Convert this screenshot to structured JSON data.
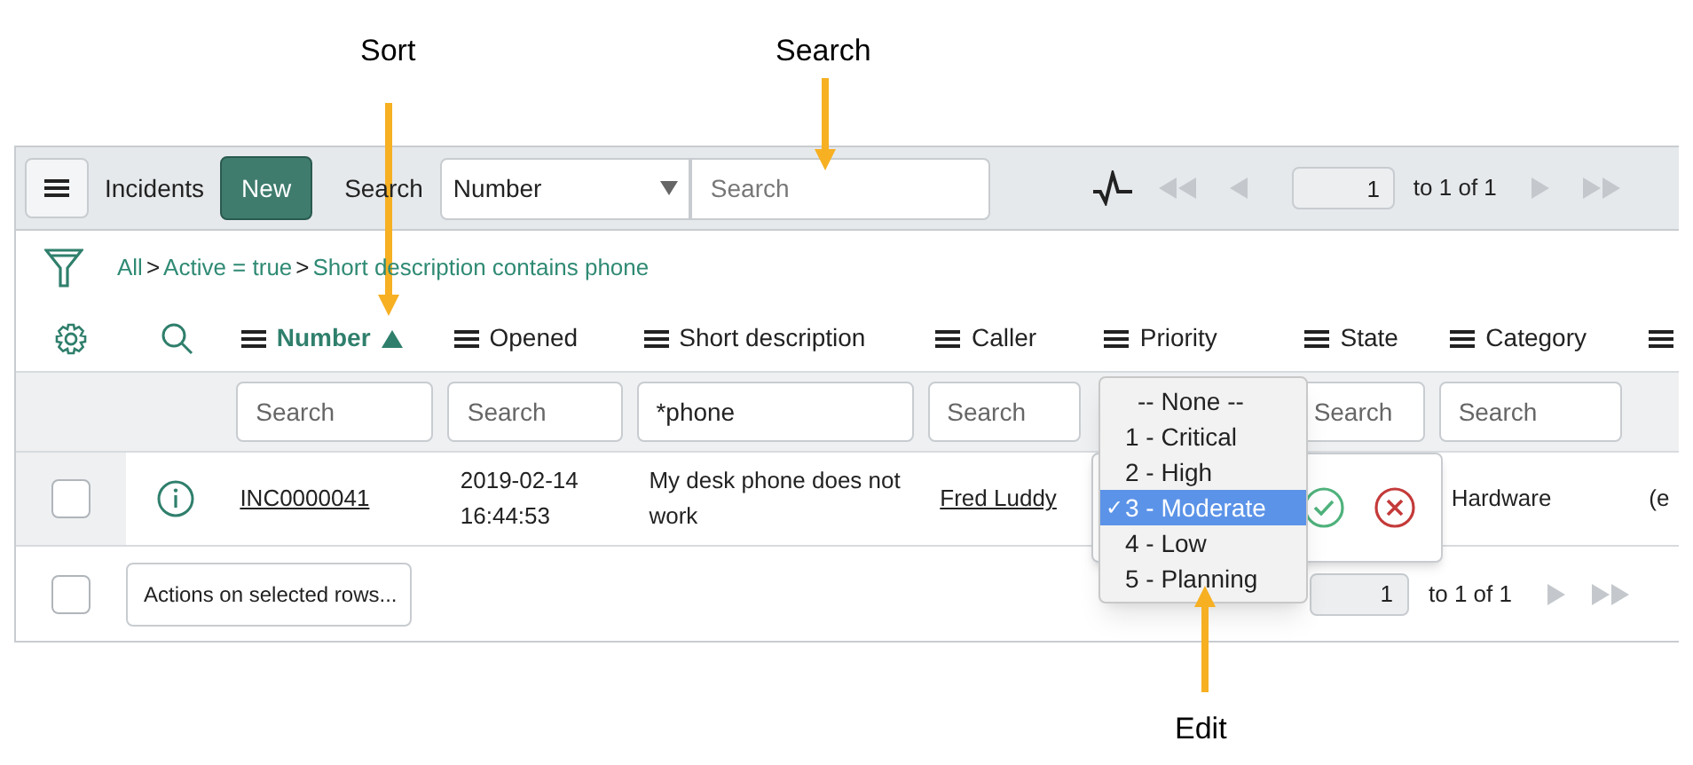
{
  "annotations": [
    {
      "label": "Sort",
      "kind": "down"
    },
    {
      "label": "Search",
      "kind": "down"
    },
    {
      "label": "Edit",
      "kind": "up"
    }
  ],
  "toolbar": {
    "title": "Incidents",
    "new_button": "New",
    "search_label": "Search",
    "field_select": "Number",
    "search_placeholder": "Search",
    "page_input": "1",
    "page_range": "to 1 of 1"
  },
  "breadcrumb": {
    "separator": ">",
    "items": [
      {
        "label": "All"
      },
      {
        "label": "Active = true"
      },
      {
        "label": "Short description contains phone"
      }
    ]
  },
  "columns": [
    {
      "label": "Number",
      "sorted": true,
      "filter": {
        "placeholder": "Search"
      }
    },
    {
      "label": "Opened",
      "sorted": false,
      "filter": {
        "placeholder": "Search"
      }
    },
    {
      "label": "Short description",
      "sorted": false,
      "filter": {
        "value": "*phone"
      }
    },
    {
      "label": "Caller",
      "sorted": false,
      "filter": {
        "placeholder": "Search"
      }
    },
    {
      "label": "Priority",
      "sorted": false
    },
    {
      "label": "State",
      "sorted": false,
      "filter": {
        "placeholder": "Search"
      }
    },
    {
      "label": "Category",
      "sorted": false,
      "filter": {
        "placeholder": "Search"
      }
    },
    {
      "sorted": false
    }
  ],
  "rows": [
    {
      "checked": false,
      "cells": [
        {
          "kind": "link",
          "text": "INC0000041"
        },
        {
          "kind": "text",
          "text": "2019-02-14 16:44:53"
        },
        {
          "kind": "text",
          "text": "My desk phone does not work"
        },
        {
          "kind": "link",
          "text": "Fred Luddy"
        },
        {
          "kind": "empty"
        },
        {
          "kind": "empty"
        },
        {
          "kind": "text",
          "text": "Hardware"
        },
        {
          "kind": "text",
          "text": "(e"
        }
      ]
    }
  ],
  "editor": {
    "check_mark": "✓",
    "options": [
      {
        "label": "-- None --",
        "selected": false
      },
      {
        "label": "1 - Critical",
        "selected": false
      },
      {
        "label": "2 - High",
        "selected": false
      },
      {
        "label": "3 - Moderate",
        "selected": true
      },
      {
        "label": "4 - Low",
        "selected": false
      },
      {
        "label": "5 - Planning",
        "selected": false
      }
    ]
  },
  "footer": {
    "checked": false,
    "actions_select": "Actions on selected rows...",
    "page_input": "1",
    "page_range": "to 1 of 1"
  }
}
